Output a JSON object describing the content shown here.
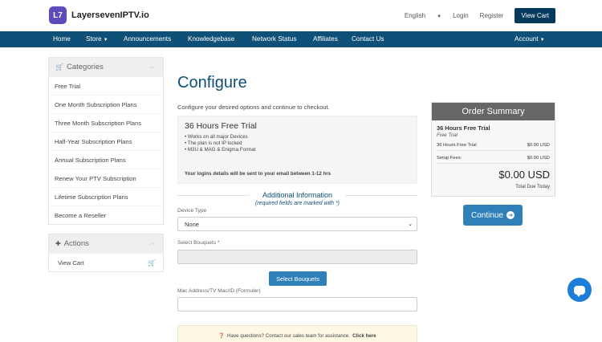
{
  "header": {
    "logo_badge": "L7",
    "logo_text": "LayersevenIPTV.io",
    "language": "English",
    "login": "Login",
    "register": "Register",
    "view_cart": "View Cart"
  },
  "nav": {
    "items": [
      "Home",
      "Store",
      "Announcements",
      "Knowledgebase",
      "Network Status",
      "Affiliates",
      "Contact Us"
    ],
    "account": "Account"
  },
  "sidebar": {
    "categories_title": "Categories",
    "categories": [
      "Free Trial",
      "One Month Subscription Plans",
      "Three Month Subscription Plans",
      "Half-Year Subscription Plans",
      "Annual Subscription Plans",
      "Renew Your PTV Subscription",
      "Lifetime Subscription Plans",
      "Become a Reseller"
    ],
    "actions_title": "Actions",
    "actions": [
      "View Cart"
    ]
  },
  "main": {
    "title": "Configure",
    "subtitle": "Configure your desired options and continue to checkout.",
    "product": {
      "name": "36 Hours Free Trial",
      "features": [
        "• Works on all major Devices",
        "• The plan is not IP locked",
        "• M3U & MAG & Enigma Format"
      ],
      "logins_note": "Your logins details will be sent to your email between 1-12 hrs"
    },
    "additional_info": {
      "title": "Additional Information",
      "subtitle": "(required fields are marked with *)"
    },
    "fields": {
      "device_type_label": "Device Type",
      "device_type_value": "None",
      "bouquets_label": "Select Bouquets *",
      "bouquets_button": "Select Bouquets",
      "mac_label": "Mac Address/TV Mac/ID (Formuler)"
    },
    "help": {
      "text": "Have questions? Contact our sales team for assistance.",
      "link": "Click here"
    }
  },
  "summary": {
    "title": "Order Summary",
    "product_name": "36 Hours Free Trial",
    "product_group": "Free Trial",
    "line_item": "36 Hours Free Trial",
    "line_price": "$0.00 USD",
    "setup_label": "Setup Fees:",
    "setup_price": "$0.00 USD",
    "total": "$0.00 USD",
    "total_label": "Total Due Today",
    "continue": "Continue"
  }
}
